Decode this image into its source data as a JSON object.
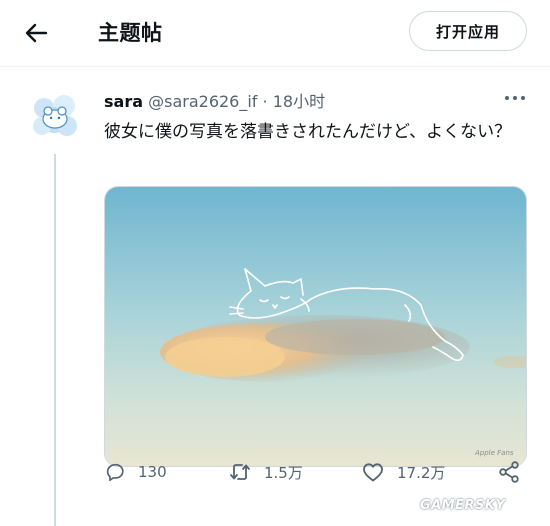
{
  "header": {
    "title": "主题帖",
    "open_app_label": "打开应用"
  },
  "tweet": {
    "author_name": "sara",
    "author_handle": "@sara2626_if",
    "separator": "·",
    "timestamp": "18小时",
    "text": "彼女に僕の写真を落書きされたんだけど、よくない？",
    "media_signature": "Apple Fans"
  },
  "actions": {
    "reply_count": "130",
    "retweet_count": "1.5万",
    "like_count": "17.2万"
  },
  "watermark": "GAMERSKY",
  "icons": {
    "back": "arrow-left-icon",
    "more": "more-horizontal-icon",
    "reply": "comment-icon",
    "retweet": "retweet-icon",
    "like": "heart-icon",
    "share": "share-icon"
  }
}
